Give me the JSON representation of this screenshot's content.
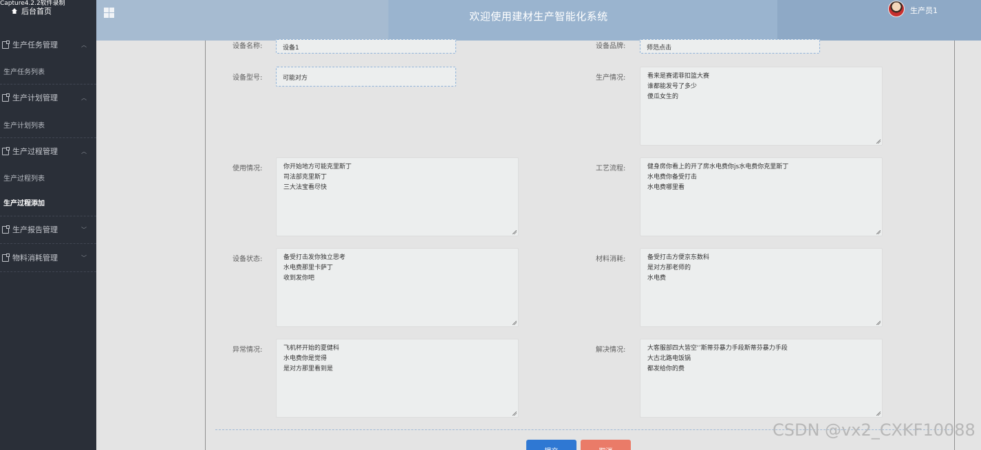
{
  "capture_label": "Capture4.2.2软件录制",
  "sidebar": {
    "home_label": "后台首页",
    "groups": [
      {
        "label": "生产任务管理",
        "chevron": "^",
        "sub": "生产任务列表"
      },
      {
        "label": "生产计划管理",
        "chevron": "^",
        "sub": "生产计划列表"
      },
      {
        "label": "生产过程管理",
        "chevron": "^",
        "sub": "生产过程列表",
        "sub2": "生产过程添加"
      },
      {
        "label": "生产报告管理",
        "chevron": "v"
      },
      {
        "label": "物料消耗管理",
        "chevron": "v"
      }
    ]
  },
  "header": {
    "title": "欢迎使用建材生产智能化系统",
    "user": "生产员1"
  },
  "form": {
    "device_name": {
      "label": "设备名称:",
      "value": "设备1"
    },
    "device_brand": {
      "label": "设备品牌:",
      "value": "师范点击"
    },
    "device_model": {
      "label": "设备型号:",
      "value": "可能对方"
    },
    "production": {
      "label": "生产情况:",
      "lines": [
        "看来是赛诺菲扣篮大赛",
        "谁都能发号了多少",
        "傻瓜女生的"
      ]
    },
    "usage": {
      "label": "使用情况:",
      "lines": [
        "你开始地方可能克里斯丁",
        "司法部克里斯丁",
        "三大法宝看尽快"
      ]
    },
    "process": {
      "label": "工艺流程:",
      "lines": [
        "健身房你看上的开了房水电费你js水电费你克里斯丁",
        "水电费你备受打击",
        "水电费哪里看"
      ]
    },
    "status": {
      "label": "设备状态:",
      "lines": [
        "备受打击发你独立思考",
        "水电费那里卡萨丁",
        "收到发你吧"
      ]
    },
    "material": {
      "label": "材料消耗:",
      "lines": [
        "备受打击方便京东数科",
        "是对方那老师的",
        "水电费"
      ]
    },
    "abnormal": {
      "label": "异常情况:",
      "lines": [
        "飞机杯开始的夏健科",
        "水电费你是觉得",
        "是对方那里看到是"
      ]
    },
    "solution": {
      "label": "解决情况:",
      "lines": [
        "大客服部四大皆空‘’斯蒂芬暴力手段斯蒂芬暴力手段",
        "大古北路电饭锅",
        "都发给你的费"
      ]
    }
  },
  "buttons": {
    "submit": "提交",
    "cancel": "取消"
  },
  "watermark": "CSDN @vx2_CXKF10088",
  "colors": {
    "sidebar_bg": "#2a2f38",
    "header_bg": "#9ab4cf",
    "submit": "#2f78d3",
    "cancel": "#ea7b68"
  }
}
